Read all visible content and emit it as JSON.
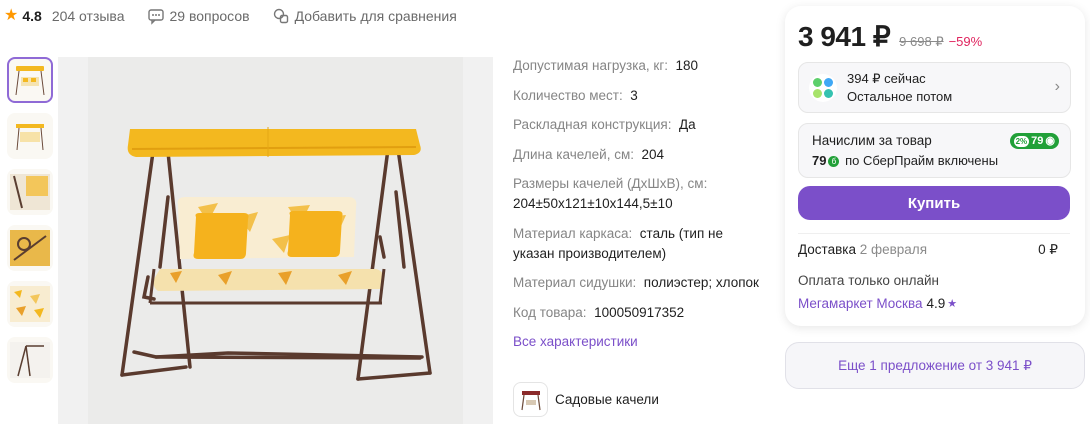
{
  "meta": {
    "rating": "4.8",
    "reviews": "204 отзыва",
    "questions": "29 вопросов",
    "compare": "Добавить для сравнения"
  },
  "specs": [
    {
      "k": "Допустимая нагрузка, кг:",
      "v": "180"
    },
    {
      "k": "Количество мест:",
      "v": "3"
    },
    {
      "k": "Раскладная конструкция:",
      "v": "Да"
    },
    {
      "k": "Длина качелей, см:",
      "v": "204"
    },
    {
      "k": "Размеры качелей (ДхШхВ), см:",
      "v": "204±50х121±10х144,5±10"
    },
    {
      "k": "Материал каркаса:",
      "v": "сталь (тип не указан производителем)"
    },
    {
      "k": "Материал сидушки:",
      "v": "полиэстер; хлопок"
    },
    {
      "k": "Код товара:",
      "v": "100050917352"
    }
  ],
  "all_specs_link": "Все характеристики",
  "category": "Садовые качели",
  "offer": {
    "price": "3 941 ₽",
    "old_price": "9 698 ₽",
    "discount": "−59%",
    "split_now": "394 ₽ сейчас",
    "split_rest": "Остальное потом",
    "bonus_title": "Начислим за товар",
    "bonus_badge_pct": "2%",
    "bonus_badge_value": "79",
    "bonus_amount": "79",
    "bonus_text": "по СберПрайм включены",
    "buy_label": "Купить",
    "delivery_label": "Доставка",
    "delivery_date": "2 февраля",
    "delivery_price": "0 ₽",
    "payment_note": "Оплата только онлайн",
    "seller_name": "Мегамаркет Москва",
    "seller_rating": "4.9"
  },
  "more_offers": "Еще 1 предложение от 3 941 ₽",
  "colors": {
    "accent": "#7b4fc9",
    "discount": "#e0245e",
    "bonus": "#21a038",
    "star": "#ff9800"
  }
}
